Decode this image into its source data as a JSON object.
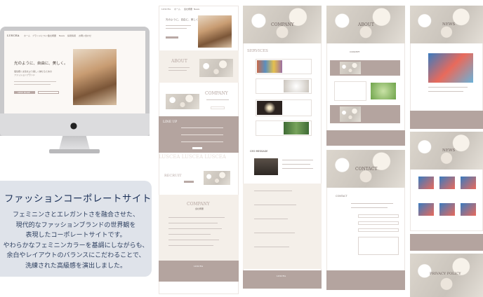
{
  "brand": "LUSCEA",
  "nav": [
    "ホーム",
    "ブランドについて",
    "会社概要",
    "News",
    "採用情報",
    "お問い合わせ"
  ],
  "hero": {
    "headline": "光のように、自由に、美しく。",
    "body_lines": [
      "個性輝く女性をより美しく魅せるための",
      "ファッションブランド"
    ],
    "button": "VIEW MORE"
  },
  "info": {
    "title": "ファッションコーポレートサイト",
    "lines": [
      "フェミニンさとエレガントさを融合させた、",
      "現代的なファッションブランドの世界観を",
      "表現したコーポレートサイトです。",
      "やわらかなフェミニンカラーを基調にしながらも、",
      "余白やレイアウトのバランスにこだわることで、",
      "洗練された高級感を演出しました。"
    ]
  },
  "pages": {
    "home_head": "光のように、自由に、美しく。",
    "about": "ABOUT",
    "company": "COMPANY",
    "company_sub": "会社概要",
    "lineup": "LINE UP",
    "lineup_ticker": "LUSCEA LUSCEA LUSCEA",
    "recruit": "RECRUIT",
    "services": "SERVICES",
    "ceo_message": "CEO MESSAGE",
    "contact": "CONTACT",
    "news": "NEWS",
    "privacy": "PRIVACY POLICY",
    "concept": "CONCEPT"
  },
  "colors": {
    "accent_taupe": "#b4a49f",
    "beige": "#f4efe9",
    "info_bg": "#dfe3ea",
    "info_text": "#1a2f57"
  }
}
